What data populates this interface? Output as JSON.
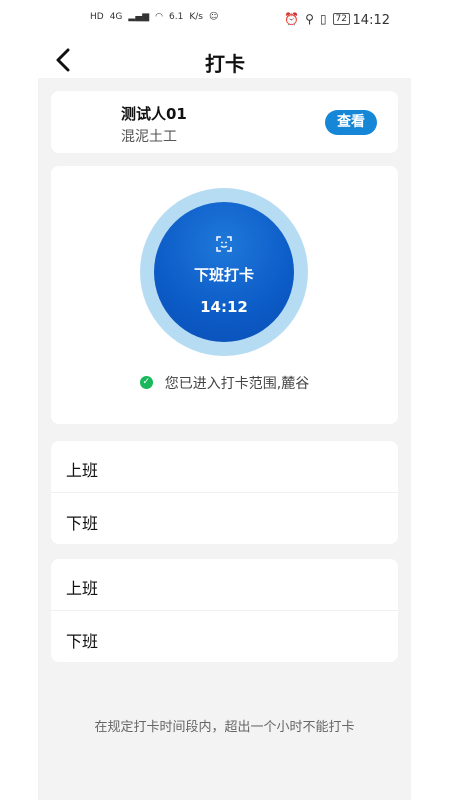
{
  "status_bar": {
    "network_left": "HD",
    "signal": "4G",
    "speed_value": "6.1",
    "speed_unit": "K/s",
    "battery": "72",
    "time": "14:12"
  },
  "nav": {
    "title": "打卡"
  },
  "user": {
    "name": "测试人01",
    "role": "混泥土工",
    "view_label": "查看"
  },
  "punch": {
    "label": "下班打卡",
    "time": "14:12",
    "range_text": "您已进入打卡范围,麓谷"
  },
  "shifts": [
    {
      "on_label": "上班",
      "off_label": "下班"
    },
    {
      "on_label": "上班",
      "off_label": "下班"
    }
  ],
  "footer_note": "在规定打卡时间段内，超出一个小时不能打卡",
  "colors": {
    "accent": "#1587d6",
    "punch_button": "#0c5bc7",
    "ring": "#b6dcf3",
    "success": "#19b95b"
  }
}
